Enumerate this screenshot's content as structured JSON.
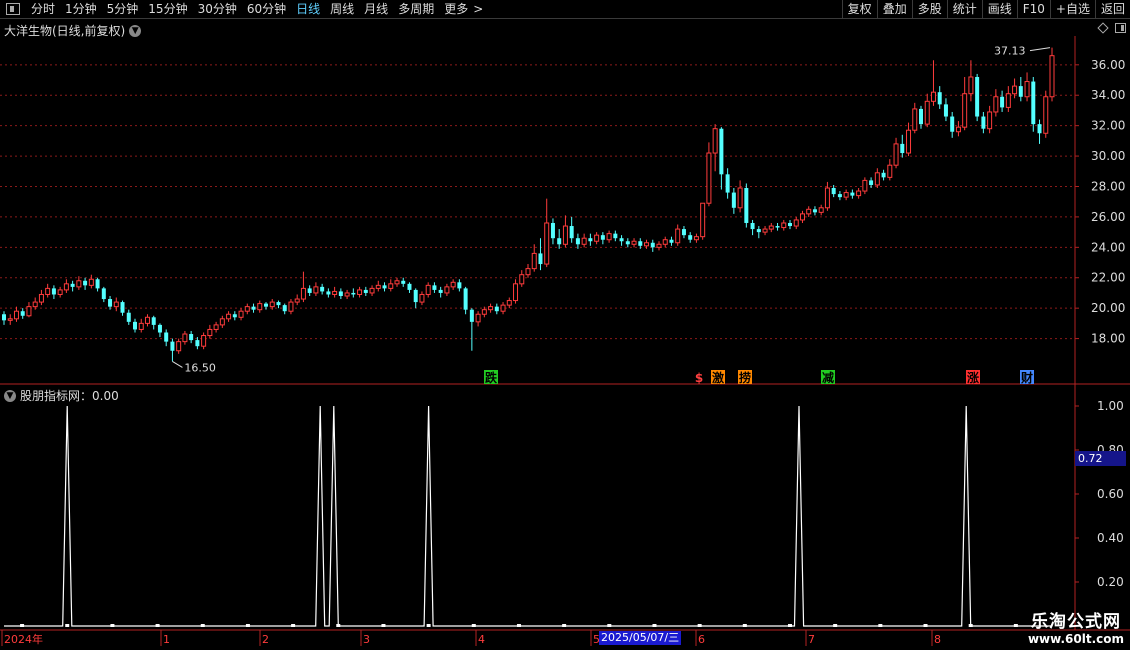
{
  "toolbar": {
    "periods": [
      "分时",
      "1分钟",
      "5分钟",
      "15分钟",
      "30分钟",
      "60分钟",
      "日线",
      "周线",
      "月线",
      "多周期",
      "更多"
    ],
    "active_period": "日线",
    "more_arrow": ">",
    "buttons": [
      "复权",
      "叠加",
      "多股",
      "统计",
      "画线",
      "F10",
      "+自选",
      "返回"
    ]
  },
  "main_chart": {
    "title": "大洋生物(日线,前复权)",
    "price_ticks": [
      "36.00",
      "34.00",
      "32.00",
      "30.00",
      "28.00",
      "26.00",
      "24.00",
      "22.00",
      "20.00",
      "18.00"
    ],
    "high_label": "37.13",
    "low_label": "16.50",
    "markers": [
      {
        "text": "跌",
        "color": "#22cc22"
      },
      {
        "text": "$",
        "color": "#ff4040"
      },
      {
        "text": "激",
        "color": "#ff8800"
      },
      {
        "text": "捞",
        "color": "#ff8800"
      },
      {
        "text": "减",
        "color": "#22cc22"
      },
      {
        "text": "涨",
        "color": "#ff3030"
      },
      {
        "text": "财",
        "color": "#4488ff"
      }
    ]
  },
  "indicator": {
    "title": "股朋指标网：0.00",
    "ticks": [
      "1.00",
      "0.80",
      "0.60",
      "0.40",
      "0.20"
    ],
    "current_value": "0.72"
  },
  "time_axis": {
    "labels": [
      "2024年",
      "1",
      "2",
      "3",
      "4",
      "5",
      "6",
      "7",
      "8"
    ],
    "highlight_date": "2025/05/07/三"
  },
  "watermark": {
    "line1": "乐淘公式网",
    "line2": "www.60lt.com"
  },
  "colors": {
    "up": "#ff3c3c",
    "down": "#54ffff",
    "grid": "#8b1a1a",
    "axis": "#b22222",
    "active": "#5fd0ff"
  },
  "chart_data": {
    "type": "candlestick",
    "ylim": [
      16,
      37.5
    ],
    "candles": [
      [
        19.6,
        19.2,
        19.8,
        18.9
      ],
      [
        19.2,
        19.3,
        19.6,
        18.9
      ],
      [
        19.3,
        19.8,
        20.1,
        19.1
      ],
      [
        19.8,
        19.5,
        20.0,
        19.3
      ],
      [
        19.5,
        20.1,
        20.4,
        19.4
      ],
      [
        20.1,
        20.4,
        20.7,
        19.9
      ],
      [
        20.4,
        20.9,
        21.2,
        20.2
      ],
      [
        20.9,
        21.3,
        21.6,
        20.7
      ],
      [
        21.3,
        20.9,
        21.5,
        20.6
      ],
      [
        20.9,
        21.2,
        21.4,
        20.7
      ],
      [
        21.2,
        21.6,
        21.9,
        21.0
      ],
      [
        21.6,
        21.4,
        21.8,
        21.1
      ],
      [
        21.4,
        21.8,
        22.1,
        21.2
      ],
      [
        21.8,
        21.5,
        22.0,
        21.2
      ],
      [
        21.5,
        21.9,
        22.2,
        21.3
      ],
      [
        21.9,
        21.3,
        22.0,
        21.1
      ],
      [
        21.3,
        20.6,
        21.4,
        20.4
      ],
      [
        20.6,
        20.1,
        20.8,
        19.9
      ],
      [
        20.1,
        20.4,
        20.7,
        19.8
      ],
      [
        20.4,
        19.7,
        20.5,
        19.5
      ],
      [
        19.7,
        19.1,
        19.9,
        18.9
      ],
      [
        19.1,
        18.6,
        19.3,
        18.4
      ],
      [
        18.6,
        19.0,
        19.3,
        18.4
      ],
      [
        19.0,
        19.4,
        19.6,
        18.8
      ],
      [
        19.4,
        18.9,
        19.5,
        18.6
      ],
      [
        18.9,
        18.4,
        19.0,
        18.1
      ],
      [
        18.4,
        17.8,
        18.6,
        17.5
      ],
      [
        17.8,
        17.2,
        18.0,
        16.5
      ],
      [
        17.2,
        17.8,
        18.0,
        17.0
      ],
      [
        17.8,
        18.3,
        18.5,
        17.6
      ],
      [
        18.3,
        17.9,
        18.5,
        17.7
      ],
      [
        17.9,
        17.5,
        18.1,
        17.3
      ],
      [
        17.5,
        18.2,
        18.4,
        17.3
      ],
      [
        18.2,
        18.6,
        18.9,
        18.0
      ],
      [
        18.6,
        18.9,
        19.1,
        18.4
      ],
      [
        18.9,
        19.3,
        19.5,
        18.7
      ],
      [
        19.3,
        19.6,
        19.8,
        19.1
      ],
      [
        19.6,
        19.4,
        19.8,
        19.2
      ],
      [
        19.4,
        19.8,
        20.0,
        19.2
      ],
      [
        19.8,
        20.1,
        20.3,
        19.6
      ],
      [
        20.1,
        19.9,
        20.3,
        19.7
      ],
      [
        19.9,
        20.3,
        20.5,
        19.7
      ],
      [
        20.3,
        20.1,
        20.4,
        19.9
      ],
      [
        20.1,
        20.4,
        20.6,
        19.9
      ],
      [
        20.4,
        20.2,
        20.5,
        20.0
      ],
      [
        20.2,
        19.8,
        20.3,
        19.6
      ],
      [
        19.8,
        20.4,
        20.6,
        19.6
      ],
      [
        20.4,
        20.6,
        20.9,
        20.2
      ],
      [
        20.6,
        21.3,
        22.4,
        20.4
      ],
      [
        21.3,
        21.0,
        21.5,
        20.8
      ],
      [
        21.0,
        21.4,
        21.7,
        20.8
      ],
      [
        21.4,
        21.1,
        21.6,
        20.9
      ],
      [
        21.1,
        20.9,
        21.3,
        20.7
      ],
      [
        20.9,
        21.1,
        21.4,
        20.7
      ],
      [
        21.1,
        20.8,
        21.3,
        20.6
      ],
      [
        20.8,
        21.0,
        21.2,
        20.6
      ],
      [
        21.0,
        20.9,
        21.3,
        20.7
      ],
      [
        20.9,
        21.2,
        21.4,
        20.7
      ],
      [
        21.2,
        21.0,
        21.4,
        20.8
      ],
      [
        21.0,
        21.3,
        21.5,
        20.8
      ],
      [
        21.3,
        21.5,
        21.8,
        21.1
      ],
      [
        21.5,
        21.3,
        21.7,
        21.1
      ],
      [
        21.3,
        21.6,
        21.9,
        21.1
      ],
      [
        21.6,
        21.8,
        22.0,
        21.4
      ],
      [
        21.8,
        21.6,
        22.0,
        21.4
      ],
      [
        21.6,
        21.2,
        21.7,
        21.0
      ],
      [
        21.2,
        20.4,
        21.3,
        20.0
      ],
      [
        20.4,
        20.9,
        21.1,
        20.2
      ],
      [
        20.9,
        21.5,
        21.7,
        20.7
      ],
      [
        21.5,
        21.2,
        21.7,
        21.0
      ],
      [
        21.2,
        21.0,
        21.4,
        20.7
      ],
      [
        21.0,
        21.4,
        21.6,
        20.8
      ],
      [
        21.4,
        21.7,
        21.9,
        21.2
      ],
      [
        21.7,
        21.3,
        21.9,
        21.1
      ],
      [
        21.3,
        19.9,
        21.4,
        19.6
      ],
      [
        19.9,
        19.1,
        20.0,
        17.2
      ],
      [
        19.1,
        19.6,
        19.8,
        18.8
      ],
      [
        19.6,
        19.9,
        20.1,
        19.4
      ],
      [
        19.9,
        20.1,
        20.3,
        19.7
      ],
      [
        20.1,
        19.8,
        20.3,
        19.6
      ],
      [
        19.8,
        20.2,
        20.4,
        19.6
      ],
      [
        20.2,
        20.5,
        20.7,
        20.0
      ],
      [
        20.5,
        21.6,
        21.9,
        20.3
      ],
      [
        21.6,
        22.2,
        22.5,
        21.4
      ],
      [
        22.2,
        22.6,
        22.9,
        22.0
      ],
      [
        22.6,
        23.6,
        24.2,
        22.4
      ],
      [
        23.6,
        22.9,
        24.6,
        22.5
      ],
      [
        22.9,
        25.6,
        27.2,
        22.7
      ],
      [
        25.6,
        24.6,
        25.9,
        24.2
      ],
      [
        24.6,
        24.2,
        25.2,
        23.9
      ],
      [
        24.2,
        25.4,
        26.1,
        24.0
      ],
      [
        25.4,
        24.6,
        26.0,
        24.3
      ],
      [
        24.6,
        24.2,
        24.9,
        23.9
      ],
      [
        24.2,
        24.6,
        24.9,
        24.0
      ],
      [
        24.6,
        24.4,
        24.9,
        24.1
      ],
      [
        24.4,
        24.8,
        25.0,
        24.2
      ],
      [
        24.8,
        24.5,
        25.0,
        24.2
      ],
      [
        24.5,
        24.9,
        25.1,
        24.3
      ],
      [
        24.9,
        24.6,
        25.1,
        24.4
      ],
      [
        24.6,
        24.4,
        24.8,
        24.1
      ],
      [
        24.4,
        24.2,
        24.6,
        24.0
      ],
      [
        24.2,
        24.4,
        24.6,
        24.0
      ],
      [
        24.4,
        24.1,
        24.6,
        23.9
      ],
      [
        24.1,
        24.3,
        24.5,
        23.9
      ],
      [
        24.3,
        24.0,
        24.5,
        23.7
      ],
      [
        24.0,
        24.2,
        24.4,
        23.8
      ],
      [
        24.2,
        24.5,
        24.7,
        24.0
      ],
      [
        24.5,
        24.3,
        24.7,
        24.1
      ],
      [
        24.3,
        25.2,
        25.5,
        24.1
      ],
      [
        25.2,
        24.8,
        25.4,
        24.6
      ],
      [
        24.8,
        24.5,
        25.0,
        24.3
      ],
      [
        24.5,
        24.7,
        24.9,
        24.3
      ],
      [
        24.7,
        26.9,
        26.9,
        24.5
      ],
      [
        26.9,
        30.2,
        30.9,
        26.7
      ],
      [
        30.2,
        31.8,
        32.1,
        29.0
      ],
      [
        31.8,
        28.8,
        31.9,
        27.8
      ],
      [
        28.8,
        27.6,
        29.2,
        27.2
      ],
      [
        27.6,
        26.6,
        27.9,
        26.2
      ],
      [
        26.6,
        27.9,
        28.4,
        26.3
      ],
      [
        27.9,
        25.6,
        28.2,
        25.3
      ],
      [
        25.6,
        25.2,
        25.8,
        24.8
      ],
      [
        25.2,
        25.0,
        25.4,
        24.6
      ],
      [
        25.0,
        25.2,
        25.4,
        24.8
      ],
      [
        25.2,
        25.4,
        25.6,
        25.0
      ],
      [
        25.4,
        25.3,
        25.6,
        25.1
      ],
      [
        25.3,
        25.6,
        25.8,
        25.1
      ],
      [
        25.6,
        25.4,
        25.8,
        25.2
      ],
      [
        25.4,
        25.8,
        26.0,
        25.2
      ],
      [
        25.8,
        26.2,
        26.4,
        25.6
      ],
      [
        26.2,
        26.5,
        26.7,
        26.0
      ],
      [
        26.5,
        26.3,
        26.7,
        26.1
      ],
      [
        26.3,
        26.6,
        26.8,
        26.1
      ],
      [
        26.6,
        27.9,
        28.3,
        26.4
      ],
      [
        27.9,
        27.5,
        28.1,
        27.3
      ],
      [
        27.5,
        27.3,
        27.7,
        27.1
      ],
      [
        27.3,
        27.6,
        27.8,
        27.1
      ],
      [
        27.6,
        27.4,
        27.8,
        27.2
      ],
      [
        27.4,
        27.7,
        27.9,
        27.2
      ],
      [
        27.7,
        28.4,
        28.6,
        27.5
      ],
      [
        28.4,
        28.1,
        28.6,
        27.9
      ],
      [
        28.1,
        28.9,
        29.2,
        27.9
      ],
      [
        28.9,
        28.6,
        29.1,
        28.4
      ],
      [
        28.6,
        29.4,
        29.8,
        28.4
      ],
      [
        29.4,
        30.8,
        31.2,
        29.2
      ],
      [
        30.8,
        30.2,
        31.4,
        29.9
      ],
      [
        30.2,
        31.7,
        32.2,
        30.0
      ],
      [
        31.7,
        33.1,
        33.5,
        31.5
      ],
      [
        33.1,
        32.1,
        33.3,
        31.8
      ],
      [
        32.1,
        33.6,
        34.1,
        31.9
      ],
      [
        33.6,
        34.2,
        36.3,
        33.3
      ],
      [
        34.2,
        33.4,
        34.6,
        33.1
      ],
      [
        33.4,
        32.6,
        33.8,
        32.3
      ],
      [
        32.6,
        31.6,
        32.9,
        31.2
      ],
      [
        31.6,
        31.9,
        32.3,
        31.3
      ],
      [
        31.9,
        34.1,
        35.2,
        31.7
      ],
      [
        34.1,
        35.2,
        36.3,
        33.6
      ],
      [
        35.2,
        32.6,
        35.4,
        32.3
      ],
      [
        32.6,
        31.8,
        32.9,
        31.5
      ],
      [
        31.8,
        32.9,
        33.3,
        31.5
      ],
      [
        32.9,
        33.9,
        34.4,
        32.6
      ],
      [
        33.9,
        33.2,
        34.3,
        32.9
      ],
      [
        33.2,
        34.1,
        34.6,
        32.9
      ],
      [
        34.1,
        34.6,
        35.1,
        33.8
      ],
      [
        34.6,
        33.9,
        35.2,
        33.6
      ],
      [
        33.9,
        34.9,
        35.5,
        33.6
      ],
      [
        34.9,
        32.1,
        35.2,
        31.6
      ],
      [
        32.1,
        31.5,
        32.4,
        30.8
      ],
      [
        31.5,
        33.9,
        34.3,
        31.2
      ],
      [
        33.9,
        36.6,
        37.13,
        33.6
      ]
    ],
    "indicator_peaks_index": [
      14,
      70,
      73,
      94,
      176,
      213
    ],
    "indicator_total_points": 233
  }
}
